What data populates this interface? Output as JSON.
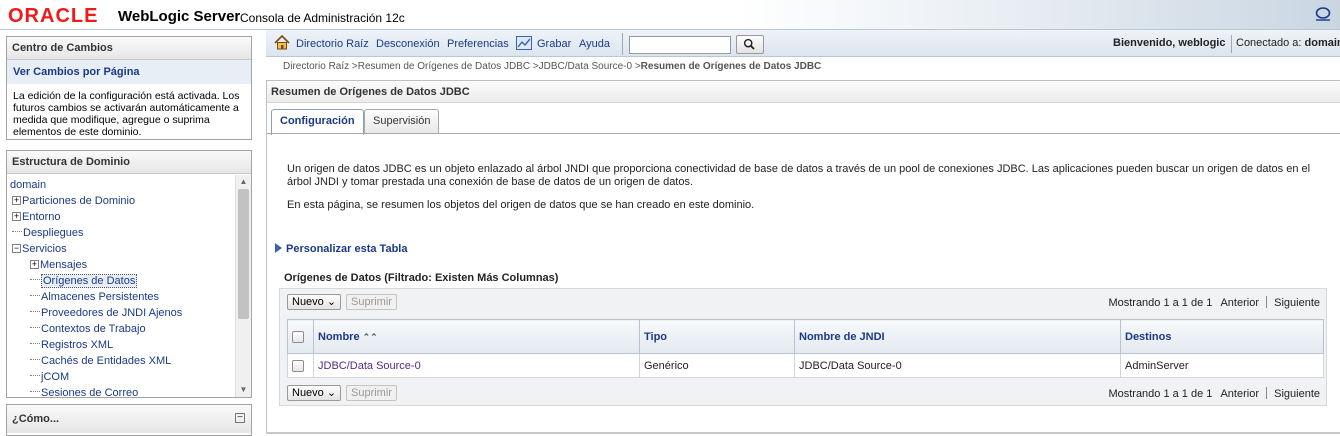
{
  "brand": {
    "oracle": "ORACLE",
    "product": "WebLogic Server",
    "subtitle": "Consola de Administración 12c"
  },
  "changes_center": {
    "title": "Centro de Cambios",
    "link": "Ver Cambios por Página",
    "text": "La edición de la configuración está activada. Los futuros cambios se activarán automáticamente a medida que modifique, agregue o suprima elementos de este dominio."
  },
  "domain_structure": {
    "title": "Estructura de Dominio",
    "items": [
      {
        "label": "domain",
        "level": 0,
        "expander": ""
      },
      {
        "label": "Particiones de Dominio",
        "level": 1,
        "expander": "+"
      },
      {
        "label": "Entorno",
        "level": 1,
        "expander": "+"
      },
      {
        "label": "Despliegues",
        "level": 1,
        "expander": ""
      },
      {
        "label": "Servicios",
        "level": 1,
        "expander": "−"
      },
      {
        "label": "Mensajes",
        "level": 2,
        "expander": "+"
      },
      {
        "label": "Orígenes de Datos",
        "level": 2,
        "expander": "",
        "selected": true
      },
      {
        "label": "Almacenes Persistentes",
        "level": 2,
        "expander": ""
      },
      {
        "label": "Proveedores de JNDI Ajenos",
        "level": 2,
        "expander": ""
      },
      {
        "label": "Contextos de Trabajo",
        "level": 2,
        "expander": ""
      },
      {
        "label": "Registros XML",
        "level": 2,
        "expander": ""
      },
      {
        "label": "Cachés de Entidades XML",
        "level": 2,
        "expander": ""
      },
      {
        "label": "jCOM",
        "level": 2,
        "expander": ""
      },
      {
        "label": "Sesiones de Correo",
        "level": 2,
        "expander": ""
      }
    ]
  },
  "howto": {
    "title": "¿Cómo...",
    "collapse": "−"
  },
  "topnav": {
    "home": "Directorio Raíz",
    "logout": "Desconexión",
    "prefs": "Preferencias",
    "record": "Grabar",
    "help": "Ayuda",
    "search_value": "",
    "welcome": "Bienvenido, weblogic",
    "connected_label": "Conectado a:",
    "connected_value": "domain"
  },
  "breadcrumb": {
    "path": "Directorio Raíz >Resumen de Orígenes de Datos JDBC >JDBC/Data Source-0 >",
    "current": "Resumen de Orígenes de Datos JDBC"
  },
  "content": {
    "title": "Resumen de Orígenes de Datos JDBC",
    "tabs": [
      "Configuración",
      "Supervisión"
    ],
    "desc1": "Un origen de datos JDBC es un objeto enlazado al árbol JNDI que proporciona conectividad de base de datos a través de un pool de conexiones JDBC. Las aplicaciones pueden buscar un origen de datos en el árbol JNDI y tomar prestada una conexión de base de datos de un origen de datos.",
    "desc2": "En esta página, se resumen los objetos del origen de datos que se han creado en este dominio.",
    "customize": "Personalizar esta Tabla",
    "table_caption": "Orígenes de Datos (Filtrado: Existen Más Columnas)"
  },
  "table": {
    "new_button": "Nuevo",
    "delete_button": "Suprimir",
    "showing": "Mostrando 1 a 1 de 1",
    "prev": "Anterior",
    "next": "Siguiente",
    "columns": [
      "Nombre",
      "Tipo",
      "Nombre de JNDI",
      "Destinos"
    ],
    "rows": [
      {
        "name": "JDBC/Data Source-0",
        "type": "Genérico",
        "jndi": "JDBC/Data Source-0",
        "targets": "AdminServer"
      }
    ]
  }
}
